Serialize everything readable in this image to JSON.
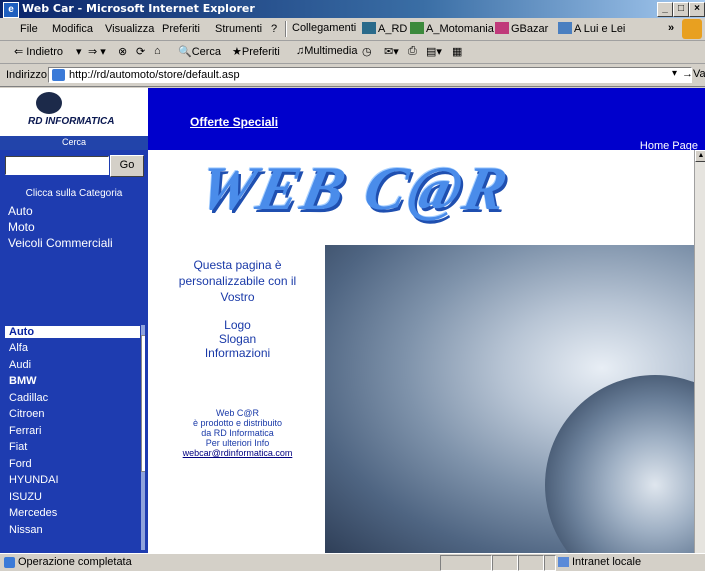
{
  "window": {
    "title": "Web Car - Microsoft Internet Explorer",
    "controls": [
      "_",
      "□",
      "×"
    ]
  },
  "menubar": {
    "items": [
      "File",
      "Modifica",
      "Visualizza",
      "Preferiti",
      "Strumenti",
      "?"
    ],
    "links": [
      "Collegamenti",
      "A_RD",
      "A_Motomania",
      "GBazar",
      "A Lui e Lei"
    ],
    "overflow": "»"
  },
  "toolbar": {
    "back": "Indietro",
    "search": "Cerca",
    "favorites": "Preferiti",
    "multimedia": "Multimedia"
  },
  "addressbar": {
    "label": "Indirizzo",
    "url": "http://rd/automoto/store/default.asp",
    "go": "Vai"
  },
  "page": {
    "logo_text": "RD INFORMATICA",
    "search_label": "Cerca",
    "nav_link": "Offerte Speciali",
    "home_link": "Home Page",
    "search": {
      "button": "Go",
      "value": ""
    },
    "category_title": "Clicca sulla Categoria",
    "categories": [
      "Auto",
      "Moto",
      "Veicoli Commerciali"
    ],
    "brands": [
      "Auto",
      "Alfa",
      "Audi",
      "BMW",
      "Cadillac",
      "Citroen",
      "Ferrari",
      "Fiat",
      "Ford",
      "HYUNDAI",
      "ISUZU",
      "Mercedes",
      "Nissan"
    ],
    "selected_brand": "Auto",
    "banner_title": "WEB C@R",
    "intro": [
      "Questa pagina è",
      "personalizzabile con il",
      "Vostro"
    ],
    "features": [
      "Logo",
      "Slogan",
      "Informazioni"
    ],
    "credits": [
      "Web C@R",
      "è prodotto e distribuito",
      "da RD Informatica",
      "Per ulteriori Info"
    ],
    "email": "webcar@rdinformatica.com"
  },
  "statusbar": {
    "text": "Operazione completata",
    "zone": "Intranet locale"
  },
  "colors": {
    "banner": "#0000cc",
    "sidebar": "#1e3cb0",
    "text_blue": "#1a3aa8"
  }
}
